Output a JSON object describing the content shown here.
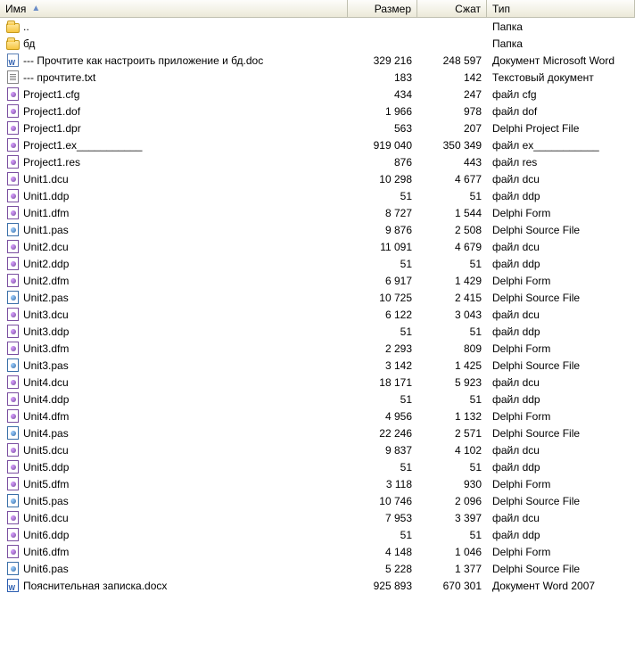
{
  "columns": {
    "name": "Имя",
    "size": "Размер",
    "packed": "Сжат",
    "type": "Тип"
  },
  "rows": [
    {
      "icon": "folder",
      "name": "..",
      "size": "",
      "packed": "",
      "type": "Папка"
    },
    {
      "icon": "folder",
      "name": "бд",
      "size": "",
      "packed": "",
      "type": "Папка"
    },
    {
      "icon": "doc",
      "name": "--- Прочтите как настроить приложение и бд.doc",
      "size": "329 216",
      "packed": "248 597",
      "type": "Документ Microsoft Word"
    },
    {
      "icon": "txt",
      "name": "--- прочтите.txt",
      "size": "183",
      "packed": "142",
      "type": "Текстовый документ"
    },
    {
      "icon": "delphi",
      "name": "Project1.cfg",
      "size": "434",
      "packed": "247",
      "type": "файл cfg"
    },
    {
      "icon": "delphi",
      "name": "Project1.dof",
      "size": "1 966",
      "packed": "978",
      "type": "файл dof"
    },
    {
      "icon": "delphi",
      "name": "Project1.dpr",
      "size": "563",
      "packed": "207",
      "type": "Delphi Project File"
    },
    {
      "icon": "delphi",
      "name": "Project1.ex___________",
      "size": "919 040",
      "packed": "350 349",
      "type": "файл ex___________"
    },
    {
      "icon": "delphi",
      "name": "Project1.res",
      "size": "876",
      "packed": "443",
      "type": "файл res"
    },
    {
      "icon": "delphi",
      "name": "Unit1.dcu",
      "size": "10 298",
      "packed": "4 677",
      "type": "файл dcu"
    },
    {
      "icon": "delphi",
      "name": "Unit1.ddp",
      "size": "51",
      "packed": "51",
      "type": "файл ddp"
    },
    {
      "icon": "delphi",
      "name": "Unit1.dfm",
      "size": "8 727",
      "packed": "1 544",
      "type": "Delphi Form"
    },
    {
      "icon": "pas",
      "name": "Unit1.pas",
      "size": "9 876",
      "packed": "2 508",
      "type": "Delphi Source File"
    },
    {
      "icon": "delphi",
      "name": "Unit2.dcu",
      "size": "11 091",
      "packed": "4 679",
      "type": "файл dcu"
    },
    {
      "icon": "delphi",
      "name": "Unit2.ddp",
      "size": "51",
      "packed": "51",
      "type": "файл ddp"
    },
    {
      "icon": "delphi",
      "name": "Unit2.dfm",
      "size": "6 917",
      "packed": "1 429",
      "type": "Delphi Form"
    },
    {
      "icon": "pas",
      "name": "Unit2.pas",
      "size": "10 725",
      "packed": "2 415",
      "type": "Delphi Source File"
    },
    {
      "icon": "delphi",
      "name": "Unit3.dcu",
      "size": "6 122",
      "packed": "3 043",
      "type": "файл dcu"
    },
    {
      "icon": "delphi",
      "name": "Unit3.ddp",
      "size": "51",
      "packed": "51",
      "type": "файл ddp"
    },
    {
      "icon": "delphi",
      "name": "Unit3.dfm",
      "size": "2 293",
      "packed": "809",
      "type": "Delphi Form"
    },
    {
      "icon": "pas",
      "name": "Unit3.pas",
      "size": "3 142",
      "packed": "1 425",
      "type": "Delphi Source File"
    },
    {
      "icon": "delphi",
      "name": "Unit4.dcu",
      "size": "18 171",
      "packed": "5 923",
      "type": "файл dcu"
    },
    {
      "icon": "delphi",
      "name": "Unit4.ddp",
      "size": "51",
      "packed": "51",
      "type": "файл ddp"
    },
    {
      "icon": "delphi",
      "name": "Unit4.dfm",
      "size": "4 956",
      "packed": "1 132",
      "type": "Delphi Form"
    },
    {
      "icon": "pas",
      "name": "Unit4.pas",
      "size": "22 246",
      "packed": "2 571",
      "type": "Delphi Source File"
    },
    {
      "icon": "delphi",
      "name": "Unit5.dcu",
      "size": "9 837",
      "packed": "4 102",
      "type": "файл dcu"
    },
    {
      "icon": "delphi",
      "name": "Unit5.ddp",
      "size": "51",
      "packed": "51",
      "type": "файл ddp"
    },
    {
      "icon": "delphi",
      "name": "Unit5.dfm",
      "size": "3 118",
      "packed": "930",
      "type": "Delphi Form"
    },
    {
      "icon": "pas",
      "name": "Unit5.pas",
      "size": "10 746",
      "packed": "2 096",
      "type": "Delphi Source File"
    },
    {
      "icon": "delphi",
      "name": "Unit6.dcu",
      "size": "7 953",
      "packed": "3 397",
      "type": "файл dcu"
    },
    {
      "icon": "delphi",
      "name": "Unit6.ddp",
      "size": "51",
      "packed": "51",
      "type": "файл ddp"
    },
    {
      "icon": "delphi",
      "name": "Unit6.dfm",
      "size": "4 148",
      "packed": "1 046",
      "type": "Delphi Form"
    },
    {
      "icon": "pas",
      "name": "Unit6.pas",
      "size": "5 228",
      "packed": "1 377",
      "type": "Delphi Source File"
    },
    {
      "icon": "docx",
      "name": "Пояснительная записка.docx",
      "size": "925 893",
      "packed": "670 301",
      "type": "Документ Word 2007"
    }
  ]
}
